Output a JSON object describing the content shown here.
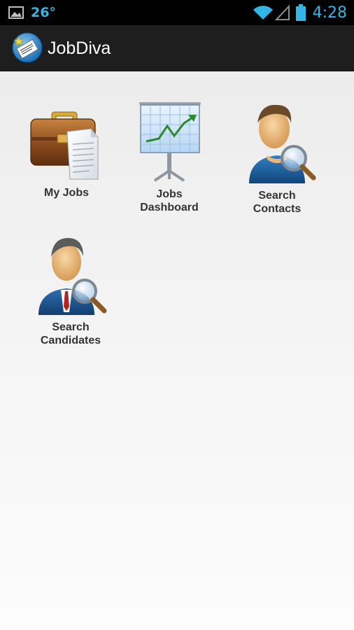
{
  "status_bar": {
    "temperature": "26°",
    "time": "4:28",
    "icons": [
      "gallery-icon",
      "wifi-icon",
      "signal-icon",
      "battery-icon"
    ],
    "accent_color": "#33b5e5"
  },
  "action_bar": {
    "title": "JobDiva",
    "logo_icon": "jobdiva-logo-icon",
    "background": "#1e1e1e"
  },
  "menu": {
    "items": [
      {
        "label": "My Jobs",
        "icon": "briefcase-icon"
      },
      {
        "label": "Jobs\nDashboard",
        "icon": "chart-board-icon"
      },
      {
        "label": "Search\nContacts",
        "icon": "contact-search-icon"
      },
      {
        "label": "Search\nCandidates",
        "icon": "candidate-search-icon"
      }
    ]
  }
}
